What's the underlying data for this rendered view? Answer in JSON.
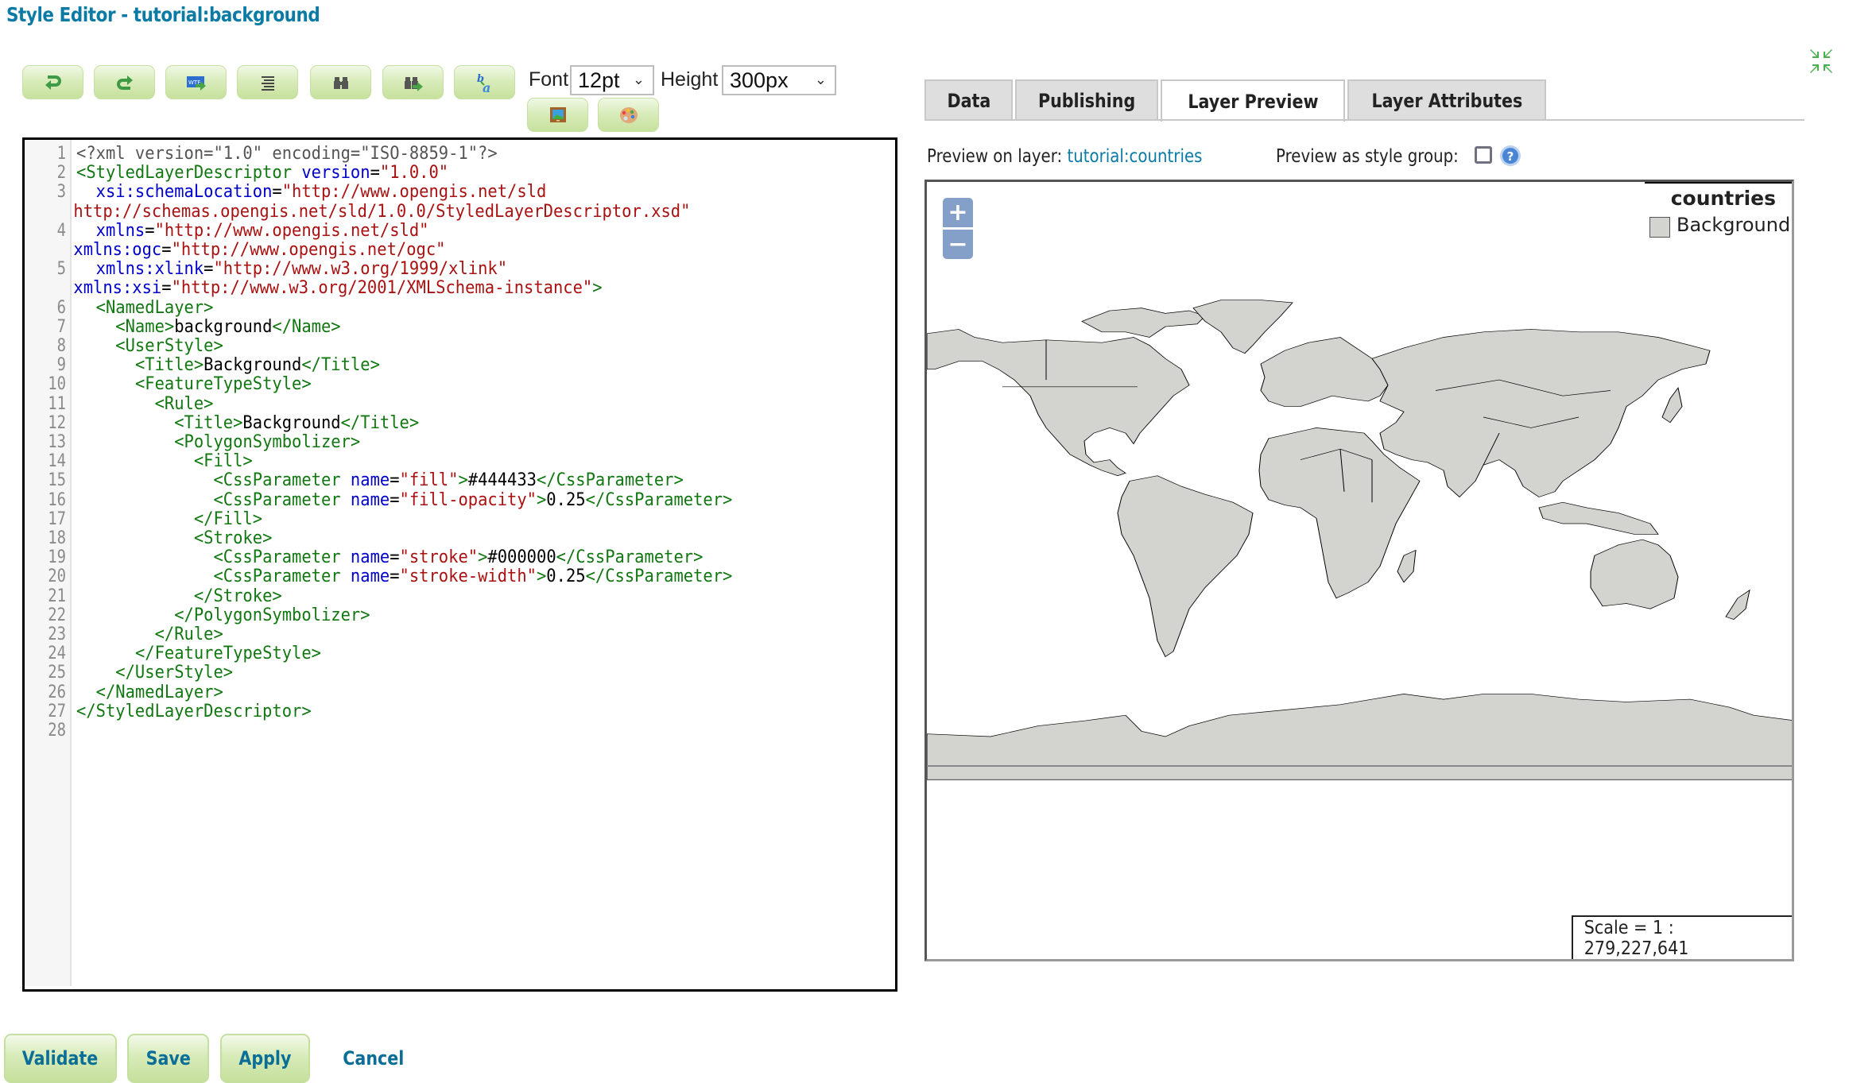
{
  "page": {
    "title": "Style Editor - tutorial:background"
  },
  "toolbar": {
    "buttons": [
      {
        "name": "undo",
        "icon": "undo-icon"
      },
      {
        "name": "redo",
        "icon": "redo-icon"
      },
      {
        "name": "go-to-line",
        "icon": "goto-line-icon"
      },
      {
        "name": "reformat",
        "icon": "reformat-icon"
      },
      {
        "name": "find",
        "icon": "binoculars-icon"
      },
      {
        "name": "find-replace",
        "icon": "binoculars-arrow-icon"
      },
      {
        "name": "replace-all",
        "icon": "replace-text-icon"
      },
      {
        "name": "insert-image",
        "icon": "image-icon"
      },
      {
        "name": "color-picker",
        "icon": "palette-icon"
      }
    ],
    "font_label": "Font",
    "font_value": "12pt",
    "height_label": "Height",
    "height_value": "300px"
  },
  "editor": {
    "lines": [
      {
        "n": "1",
        "parts": [
          [
            "pi",
            "<?xml version=\"1.0\" encoding=\"ISO-8859-1\"?>"
          ]
        ]
      },
      {
        "n": "2",
        "parts": [
          [
            "tag",
            "<StyledLayerDescriptor "
          ],
          [
            "attr",
            "version"
          ],
          [
            "txt",
            "="
          ],
          [
            "str",
            "\"1.0.0\""
          ]
        ]
      },
      {
        "n": "3",
        "parts": [
          [
            "txt",
            "  "
          ],
          [
            "attr",
            "xsi:schemaLocation"
          ],
          [
            "txt",
            "="
          ],
          [
            "str",
            "\"http://www.opengis.net/sld"
          ]
        ],
        "wrap": [
          [
            "str",
            "http://schemas.opengis.net/sld/1.0.0/StyledLayerDescriptor.xsd\""
          ]
        ]
      },
      {
        "n": "4",
        "parts": [
          [
            "txt",
            "  "
          ],
          [
            "attr",
            "xmlns"
          ],
          [
            "txt",
            "="
          ],
          [
            "str",
            "\"http://www.opengis.net/sld\""
          ]
        ],
        "wrap": [
          [
            "attr",
            "xmlns:ogc"
          ],
          [
            "txt",
            "="
          ],
          [
            "str",
            "\"http://www.opengis.net/ogc\""
          ]
        ]
      },
      {
        "n": "5",
        "parts": [
          [
            "txt",
            "  "
          ],
          [
            "attr",
            "xmlns:xlink"
          ],
          [
            "txt",
            "="
          ],
          [
            "str",
            "\"http://www.w3.org/1999/xlink\""
          ]
        ],
        "wrap": [
          [
            "attr",
            "xmlns:xsi"
          ],
          [
            "txt",
            "="
          ],
          [
            "str",
            "\"http://www.w3.org/2001/XMLSchema-instance\""
          ],
          [
            "tag",
            ">"
          ]
        ]
      },
      {
        "n": "6",
        "parts": [
          [
            "txt",
            "  "
          ],
          [
            "tag",
            "<NamedLayer>"
          ]
        ]
      },
      {
        "n": "7",
        "parts": [
          [
            "txt",
            "    "
          ],
          [
            "tag",
            "<Name>"
          ],
          [
            "txt",
            "background"
          ],
          [
            "tag",
            "</Name>"
          ]
        ]
      },
      {
        "n": "8",
        "parts": [
          [
            "txt",
            "    "
          ],
          [
            "tag",
            "<UserStyle>"
          ]
        ]
      },
      {
        "n": "9",
        "parts": [
          [
            "txt",
            "      "
          ],
          [
            "tag",
            "<Title>"
          ],
          [
            "txt",
            "Background"
          ],
          [
            "tag",
            "</Title>"
          ]
        ]
      },
      {
        "n": "10",
        "parts": [
          [
            "txt",
            "      "
          ],
          [
            "tag",
            "<FeatureTypeStyle>"
          ]
        ]
      },
      {
        "n": "11",
        "parts": [
          [
            "txt",
            "        "
          ],
          [
            "tag",
            "<Rule>"
          ]
        ]
      },
      {
        "n": "12",
        "parts": [
          [
            "txt",
            "          "
          ],
          [
            "tag",
            "<Title>"
          ],
          [
            "txt",
            "Background"
          ],
          [
            "tag",
            "</Title>"
          ]
        ]
      },
      {
        "n": "13",
        "parts": [
          [
            "txt",
            "          "
          ],
          [
            "tag",
            "<PolygonSymbolizer>"
          ]
        ]
      },
      {
        "n": "14",
        "parts": [
          [
            "txt",
            "            "
          ],
          [
            "tag",
            "<Fill>"
          ]
        ]
      },
      {
        "n": "15",
        "parts": [
          [
            "txt",
            "              "
          ],
          [
            "tag",
            "<CssParameter "
          ],
          [
            "attr",
            "name"
          ],
          [
            "txt",
            "="
          ],
          [
            "str",
            "\"fill\""
          ],
          [
            "tag",
            ">"
          ],
          [
            "txt",
            "#444433"
          ],
          [
            "tag",
            "</CssParameter>"
          ]
        ]
      },
      {
        "n": "16",
        "parts": [
          [
            "txt",
            "              "
          ],
          [
            "tag",
            "<CssParameter "
          ],
          [
            "attr",
            "name"
          ],
          [
            "txt",
            "="
          ],
          [
            "str",
            "\"fill-opacity\""
          ],
          [
            "tag",
            ">"
          ],
          [
            "txt",
            "0.25"
          ],
          [
            "tag",
            "</CssParameter>"
          ]
        ]
      },
      {
        "n": "17",
        "parts": [
          [
            "txt",
            "            "
          ],
          [
            "tag",
            "</Fill>"
          ]
        ]
      },
      {
        "n": "18",
        "parts": [
          [
            "txt",
            "            "
          ],
          [
            "tag",
            "<Stroke>"
          ]
        ]
      },
      {
        "n": "19",
        "parts": [
          [
            "txt",
            "              "
          ],
          [
            "tag",
            "<CssParameter "
          ],
          [
            "attr",
            "name"
          ],
          [
            "txt",
            "="
          ],
          [
            "str",
            "\"stroke\""
          ],
          [
            "tag",
            ">"
          ],
          [
            "txt",
            "#000000"
          ],
          [
            "tag",
            "</CssParameter>"
          ]
        ]
      },
      {
        "n": "20",
        "parts": [
          [
            "txt",
            "              "
          ],
          [
            "tag",
            "<CssParameter "
          ],
          [
            "attr",
            "name"
          ],
          [
            "txt",
            "="
          ],
          [
            "str",
            "\"stroke-width\""
          ],
          [
            "tag",
            ">"
          ],
          [
            "txt",
            "0.25"
          ],
          [
            "tag",
            "</CssParameter>"
          ]
        ]
      },
      {
        "n": "21",
        "parts": [
          [
            "txt",
            "            "
          ],
          [
            "tag",
            "</Stroke>"
          ]
        ]
      },
      {
        "n": "22",
        "parts": [
          [
            "txt",
            "          "
          ],
          [
            "tag",
            "</PolygonSymbolizer>"
          ]
        ]
      },
      {
        "n": "23",
        "parts": [
          [
            "txt",
            "        "
          ],
          [
            "tag",
            "</Rule>"
          ]
        ]
      },
      {
        "n": "24",
        "parts": [
          [
            "txt",
            "      "
          ],
          [
            "tag",
            "</FeatureTypeStyle>"
          ]
        ]
      },
      {
        "n": "25",
        "parts": [
          [
            "txt",
            "    "
          ],
          [
            "tag",
            "</UserStyle>"
          ]
        ]
      },
      {
        "n": "26",
        "parts": [
          [
            "txt",
            "  "
          ],
          [
            "tag",
            "</NamedLayer>"
          ]
        ]
      },
      {
        "n": "27",
        "parts": [
          [
            "tag",
            "</StyledLayerDescriptor>"
          ]
        ]
      },
      {
        "n": "28",
        "parts": []
      }
    ]
  },
  "tabs": [
    {
      "label": "Data",
      "active": false
    },
    {
      "label": "Publishing",
      "active": false
    },
    {
      "label": "Layer Preview",
      "active": true
    },
    {
      "label": "Layer Attributes",
      "active": false
    }
  ],
  "preview": {
    "layer_label": "Preview on layer:",
    "layer_link": "tutorial:countries",
    "group_label": "Preview as style group:",
    "group_checked": false,
    "help_icon": "help-icon"
  },
  "map": {
    "zoom_in": "+",
    "zoom_out": "−",
    "legend": {
      "title": "countries",
      "items": [
        {
          "label": "Background",
          "color": "#d3d3cf"
        }
      ]
    },
    "scale_text": "Scale = 1 : 279,227,641",
    "land_color": "#d3d3cf",
    "stroke_color": "#000000"
  },
  "actions": {
    "validate": "Validate",
    "save": "Save",
    "apply": "Apply",
    "cancel": "Cancel"
  },
  "colors": {
    "title": "#0b7ba6",
    "button_green": "#c7e19d",
    "link": "#0b7ba6",
    "zoom_button": "#84a0c8"
  }
}
